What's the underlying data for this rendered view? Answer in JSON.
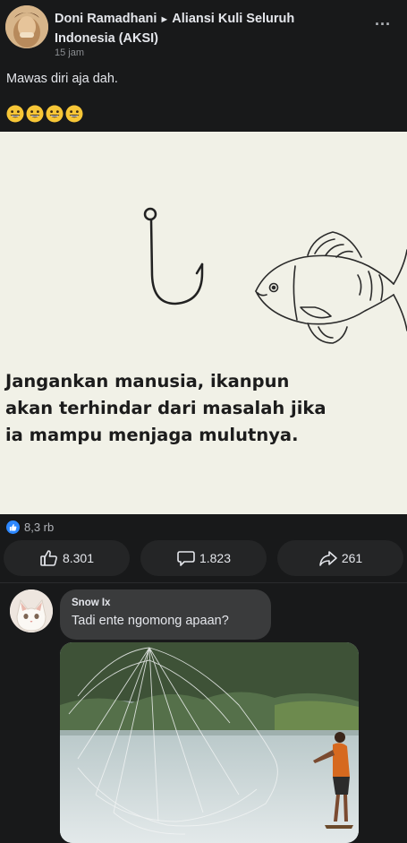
{
  "post": {
    "author": "Doni Ramadhani",
    "arrow": "►",
    "group": "Aliansi Kuli Seluruh Indonesia (AKSI)",
    "time": "15 jam",
    "more": "...",
    "text": "Mawas diri aja dah.",
    "emoji": [
      "grinning-face",
      "grinning-face",
      "grinning-face",
      "grinning-face"
    ]
  },
  "meme": {
    "caption": "Jangankan manusia, ikanpun\nakan terhindar dari masalah jika\nia mampu menjaga mulutnya."
  },
  "reactions": {
    "count": "8,3 rb",
    "icon": "like-icon",
    "color": "#2d88ff"
  },
  "actions": {
    "like": "8.301",
    "comment": "1.823",
    "share": "261"
  },
  "comment": {
    "name": "Snow Ix",
    "text": "Tadi ente ngomong apaan?"
  },
  "colors": {
    "background": "#18191a",
    "button": "#242526",
    "bubble": "#3a3b3c",
    "meme_bg": "#f1f1e7"
  }
}
